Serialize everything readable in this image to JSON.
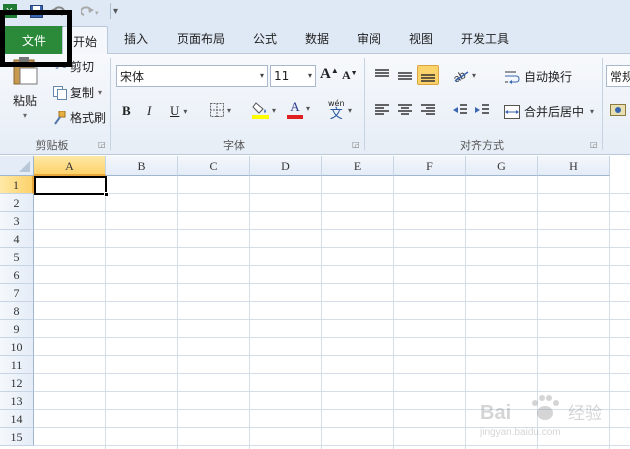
{
  "quick_access": {
    "icons": [
      "excel-logo-icon",
      "save-icon",
      "undo-icon",
      "redo-icon",
      "customize-qat-icon"
    ]
  },
  "tabs": [
    {
      "id": "file",
      "label": "文件"
    },
    {
      "id": "home",
      "label": "开始"
    },
    {
      "id": "insert",
      "label": "插入"
    },
    {
      "id": "page_layout",
      "label": "页面布局"
    },
    {
      "id": "formulas",
      "label": "公式"
    },
    {
      "id": "data",
      "label": "数据"
    },
    {
      "id": "review",
      "label": "审阅"
    },
    {
      "id": "view",
      "label": "视图"
    },
    {
      "id": "developer",
      "label": "开发工具"
    }
  ],
  "ribbon": {
    "clipboard": {
      "paste": "粘贴",
      "cut": "剪切",
      "copy": "复制",
      "format_painter": "格式刷",
      "group_label": "剪贴板"
    },
    "font": {
      "font_name": "宋体",
      "font_size": "11",
      "grow_label": "A",
      "shrink_label": "A",
      "bold": "B",
      "italic": "I",
      "underline": "U",
      "font_color_label": "A",
      "phonetic_top": "wén",
      "phonetic_bottom": "文",
      "group_label": "字体"
    },
    "alignment": {
      "wrap_text": "自动换行",
      "merge_center": "合并后居中",
      "group_label": "对齐方式"
    },
    "number": {
      "format": "常规"
    }
  },
  "sheet": {
    "columns": [
      "A",
      "B",
      "C",
      "D",
      "E",
      "F",
      "G",
      "H"
    ],
    "rows": [
      "1",
      "2",
      "3",
      "4",
      "5",
      "6",
      "7",
      "8",
      "9",
      "10",
      "11",
      "12",
      "13",
      "14",
      "15"
    ],
    "active_cell": "A1",
    "active_column": "A",
    "active_row": "1"
  },
  "watermark": {
    "logo": "Bai 经验",
    "url": "jingyan.baidu.com"
  },
  "colors": {
    "file_tab": "#2a8a3a",
    "highlight_fill": "#ffff00",
    "font_color_bar": "#e02020",
    "active_header": "#fcd26b"
  }
}
